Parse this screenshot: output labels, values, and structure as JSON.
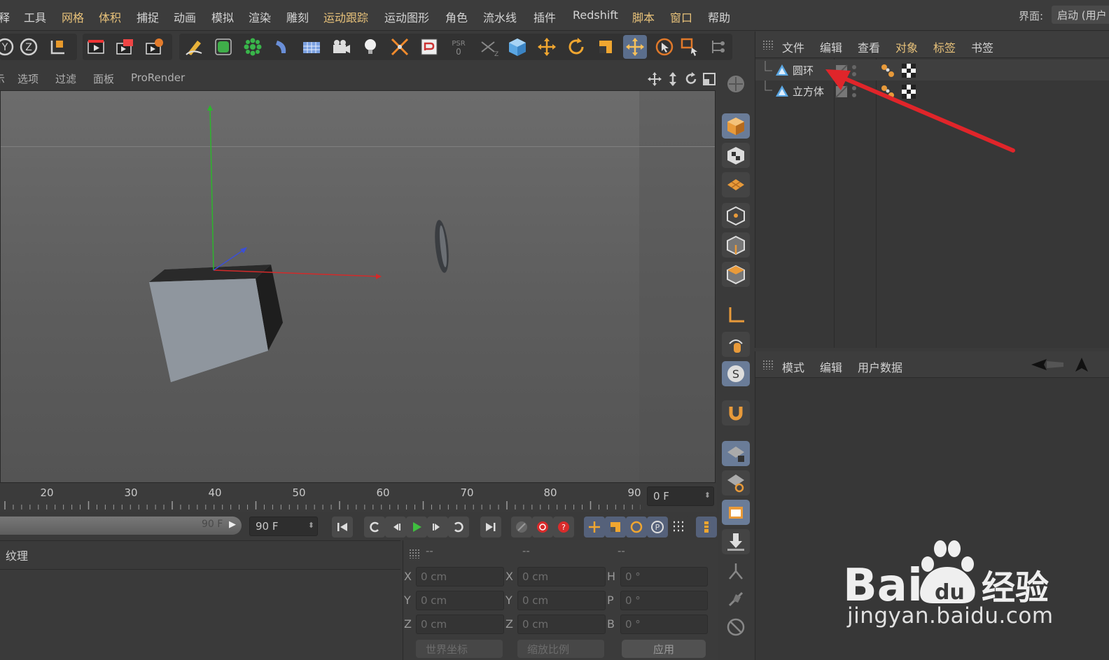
{
  "menubar": {
    "items": [
      "释",
      "工具",
      "网格",
      "体积",
      "捕捉",
      "动画",
      "模拟",
      "渲染",
      "雕刻",
      "运动跟踪",
      "运动图形",
      "角色",
      "流水线",
      "插件",
      "Redshift",
      "脚本",
      "窗口",
      "帮助"
    ],
    "interface_label": "界面:",
    "interface_value": "启动 (用户"
  },
  "viewport": {
    "menu": [
      "示",
      "选项",
      "过滤",
      "面板",
      "ProRender"
    ]
  },
  "timeline": {
    "ticks": [
      "20",
      "30",
      "40",
      "50",
      "60",
      "70",
      "80",
      "90"
    ],
    "current_frame": "0 F",
    "slider_end": "90 F",
    "end_frame": "90 F"
  },
  "materials": {
    "title": "纹理"
  },
  "coordinates": {
    "headers": [
      "--",
      "--",
      "--"
    ],
    "rows": [
      {
        "pos_label": "X",
        "pos": "0 cm",
        "size_label": "X",
        "size": "0 cm",
        "rot_label": "H",
        "rot": "0 °"
      },
      {
        "pos_label": "Y",
        "pos": "0 cm",
        "size_label": "Y",
        "size": "0 cm",
        "rot_label": "P",
        "rot": "0 °"
      },
      {
        "pos_label": "Z",
        "pos": "0 cm",
        "size_label": "Z",
        "size": "0 cm",
        "rot_label": "B",
        "rot": "0 °"
      }
    ],
    "world_dropdown": "世界坐标",
    "scale_dropdown": "缩放比例",
    "apply": "应用"
  },
  "object_manager": {
    "menu": [
      "文件",
      "编辑",
      "查看",
      "对象",
      "标签",
      "书签"
    ],
    "objects": [
      {
        "name": "圆环",
        "selected": true
      },
      {
        "name": "立方体",
        "selected": false
      }
    ]
  },
  "attributes": {
    "menu": [
      "模式",
      "编辑",
      "用户数据"
    ]
  },
  "watermark": {
    "brand_text": "Bai du 经验",
    "url": "jingyan.baidu.com"
  },
  "colors": {
    "menu_highlight": "#e8c27a",
    "annotation_arrow": "#e0252a",
    "active_button": "#5b6e8c"
  }
}
